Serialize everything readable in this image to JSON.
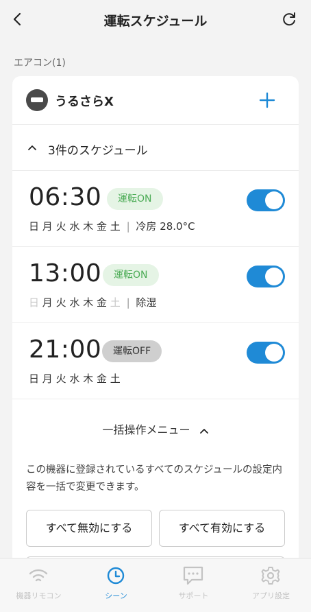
{
  "header": {
    "title": "運転スケジュール"
  },
  "section_label": "エアコン(1)",
  "device": {
    "name": "うるさらX"
  },
  "schedule_header": {
    "label": "3件のスケジュール"
  },
  "schedules": [
    {
      "time": "06:30",
      "status": "運転ON",
      "days": [
        "日",
        "月",
        "火",
        "水",
        "木",
        "金",
        "土"
      ],
      "separator": "|",
      "mode": "冷房 28.0°C",
      "enabled": true
    },
    {
      "time": "13:00",
      "status": "運転ON",
      "days": [
        "日",
        "月",
        "火",
        "水",
        "木",
        "金",
        "土"
      ],
      "separator": "|",
      "mode": "除湿",
      "enabled": true
    },
    {
      "time": "21:00",
      "status": "運転OFF",
      "days": [
        "日",
        "月",
        "火",
        "水",
        "木",
        "金",
        "土"
      ],
      "enabled": true
    }
  ],
  "bulk": {
    "label": "一括操作メニュー",
    "description": "この機器に登録されているすべてのスケジュールの設定内容を一括で変更できます。",
    "disable_all": "すべて無効にする",
    "enable_all": "すべて有効にする"
  },
  "nav": {
    "items": [
      {
        "label": "機器リモコン",
        "icon": "wifi-icon"
      },
      {
        "label": "シーン",
        "icon": "clock-icon"
      },
      {
        "label": "サポート",
        "icon": "chat-icon"
      },
      {
        "label": "アプリ設定",
        "icon": "gear-icon"
      }
    ]
  },
  "colors": {
    "accent": "#1f8ad6",
    "on_badge_bg": "#e5f4e5",
    "on_badge_text": "#4bab55",
    "off_badge_bg": "#cfcfcf"
  }
}
